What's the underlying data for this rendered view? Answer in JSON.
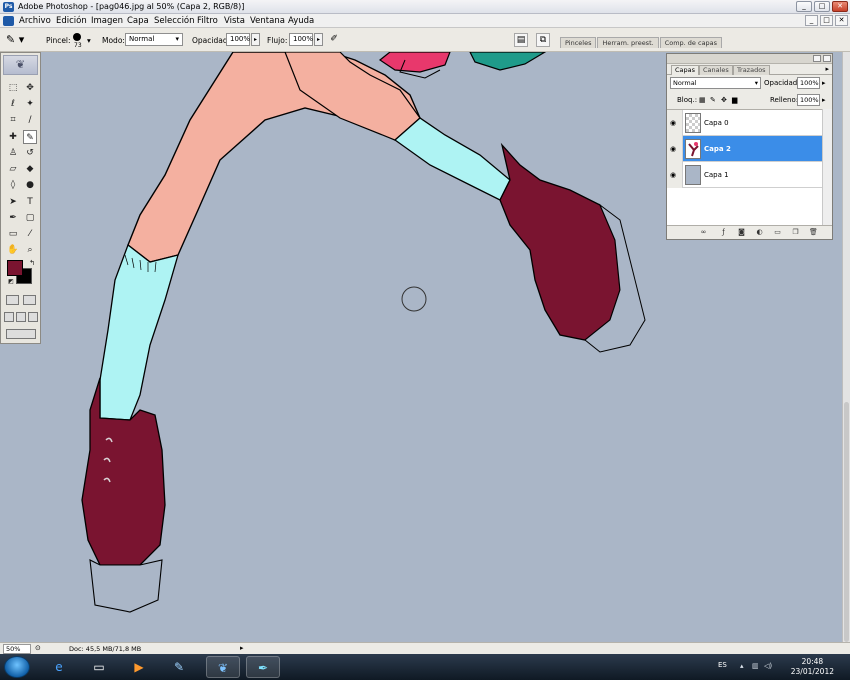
{
  "window": {
    "title": "Adobe Photoshop - [pag046.jpg al 50% (Capa 2, RGB/8)]",
    "app_icon_text": "Ps",
    "buttons": [
      "_",
      "□",
      "✕"
    ]
  },
  "menubar": {
    "items": [
      "Archivo",
      "Edición",
      "Imagen",
      "Capa",
      "Selección",
      "Filtro",
      "Vista",
      "Ventana",
      "Ayuda"
    ],
    "doc_buttons": [
      "_",
      "□",
      "✕"
    ]
  },
  "options": {
    "pincel_label": "Pincel:",
    "brush_size": "73",
    "modo_label": "Modo:",
    "modo_value": "Normal",
    "opacidad_label": "Opacidad:",
    "opacidad_value": "100%",
    "flujo_label": "Flujo:",
    "flujo_value": "100%",
    "well_tabs": [
      "Pinceles",
      "Herram. preest.",
      "Comp. de capas"
    ]
  },
  "layers_panel": {
    "tabs": [
      "Capas",
      "Canales",
      "Trazados"
    ],
    "blend_mode": "Normal",
    "opacity_label": "Opacidad:",
    "opacity_value": "100%",
    "lock_label": "Bloq.:",
    "fill_label": "Relleno:",
    "fill_value": "100%",
    "layers": [
      {
        "name": "Capa 0",
        "selected": false,
        "visible": true,
        "thumb": "checker"
      },
      {
        "name": "Capa 2",
        "selected": true,
        "visible": true,
        "thumb": "art"
      },
      {
        "name": "Capa 1",
        "selected": false,
        "visible": true,
        "thumb": "fill"
      }
    ]
  },
  "status": {
    "zoom": "50%",
    "doc": "Doc: 45,5 MB/71,8 MB"
  },
  "taskbar": {
    "lang": "ES",
    "time": "20:48",
    "date": "23/01/2012"
  },
  "colors": {
    "foreground": "#7a1430",
    "background": "#000000",
    "canvas": "#aab6c7",
    "selection": "#3b8de8",
    "skin": "#f4b0a0",
    "sock": "#aef3f3",
    "shoe": "#7a1430"
  }
}
